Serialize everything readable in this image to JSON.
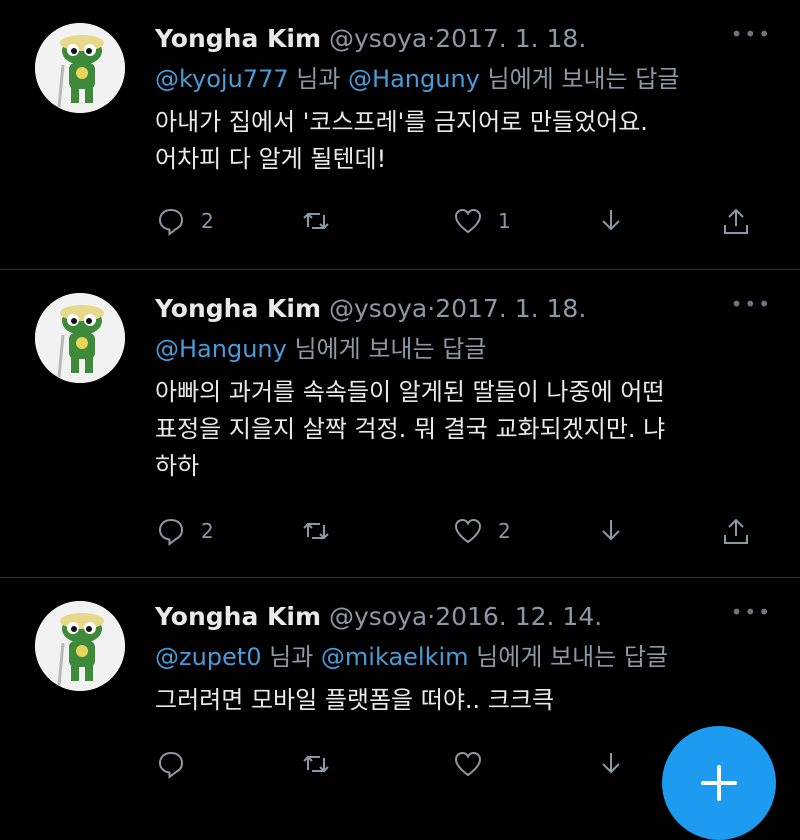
{
  "tweets": [
    {
      "name": "Yongha Kim",
      "handle": "@ysoya",
      "separator": "·",
      "date": "2017. 1. 18.",
      "reply_mention_1": "@kyoju777",
      "reply_conj": " 님과 ",
      "reply_mention_2": "@Hanguny",
      "reply_suffix": " 님에게 보내는 답글",
      "text_line_1": "아내가 집에서 '코스프레'를 금지어로 만들었어요.",
      "text_line_2": "어차피 다 알게 될텐데!",
      "text_line_3": "",
      "replies": "2",
      "retweets": "",
      "likes": "1"
    },
    {
      "name": "Yongha Kim",
      "handle": "@ysoya",
      "separator": "·",
      "date": "2017. 1. 18.",
      "reply_mention_1": "@Hanguny",
      "reply_suffix": " 님에게 보내는 답글",
      "text_line_1": "아빠의 과거를 속속들이 알게된 딸들이 나중에 어떤",
      "text_line_2": "표정을 지을지 살짝 걱정. 뭐 결국 교화되겠지만. 냐",
      "text_line_3": "하하",
      "replies": "2",
      "retweets": "",
      "likes": "2"
    },
    {
      "name": "Yongha Kim",
      "handle": "@ysoya",
      "separator": "·",
      "date": "2016. 12. 14.",
      "reply_mention_1": "@zupet0",
      "reply_conj": " 님과 ",
      "reply_mention_2": "@mikaelkim",
      "reply_suffix": " 님에게 보내는 답글",
      "text_line_1": "그러려면 모바일 플랫폼을 떠야.. 크크큭",
      "replies": "",
      "retweets": "",
      "likes": ""
    }
  ],
  "icons": {
    "reply": "reply-icon",
    "retweet": "retweet-icon",
    "like": "heart-icon",
    "bookmark": "download-icon",
    "share": "share-icon",
    "more": "more-icon",
    "compose": "plus-icon"
  },
  "colors": {
    "background": "#000000",
    "text": "#e7e9ea",
    "muted": "#8b98a5",
    "mention": "#4a9bd6",
    "fab": "#1d9bf0"
  }
}
